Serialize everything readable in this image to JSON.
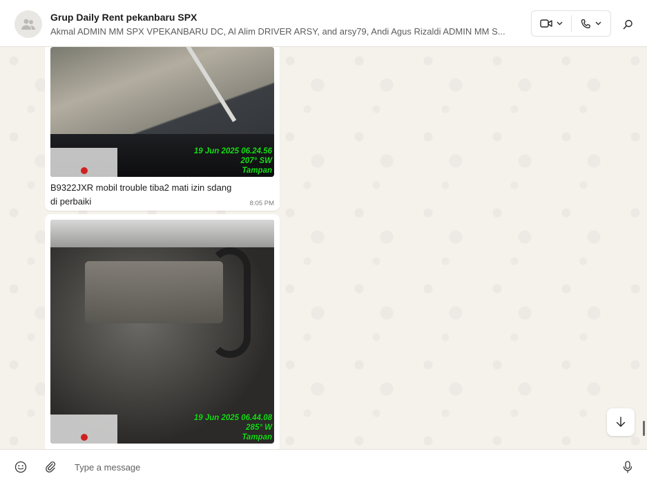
{
  "header": {
    "title": "Grup Daily Rent pekanbaru SPX",
    "participants": "Akmal ADMIN MM SPX VPEKANBARU DC, Al Alim DRIVER ARSY, and arsy79, Andi Agus Rizaldi ADMIN MM S...",
    "avatar_icon": "group-avatar-icon",
    "video_call_icon": "video-camera-icon",
    "voice_call_icon": "phone-icon",
    "search_icon": "search-icon"
  },
  "messages": [
    {
      "type": "image",
      "photo_stamp": {
        "datetime": "19 Jun 2025 06.24.56",
        "heading": "207° SW",
        "location": "Tampan"
      },
      "caption": "B9322JXR mobil trouble tiba2 mati izin sdang\ndi perbaiki",
      "time": "8:05 PM"
    },
    {
      "type": "image",
      "photo_stamp": {
        "datetime": "19 Jun 2025 06.44.08",
        "heading": "285° W",
        "location": "Tampan"
      }
    }
  ],
  "composer": {
    "placeholder": "Type a message",
    "emoji_icon": "emoji-icon",
    "attach_icon": "paperclip-icon",
    "mic_icon": "microphone-icon"
  },
  "colors": {
    "chat_background": "#f5f1eb",
    "bubble": "#ffffff",
    "stamp_text": "#19e019"
  }
}
